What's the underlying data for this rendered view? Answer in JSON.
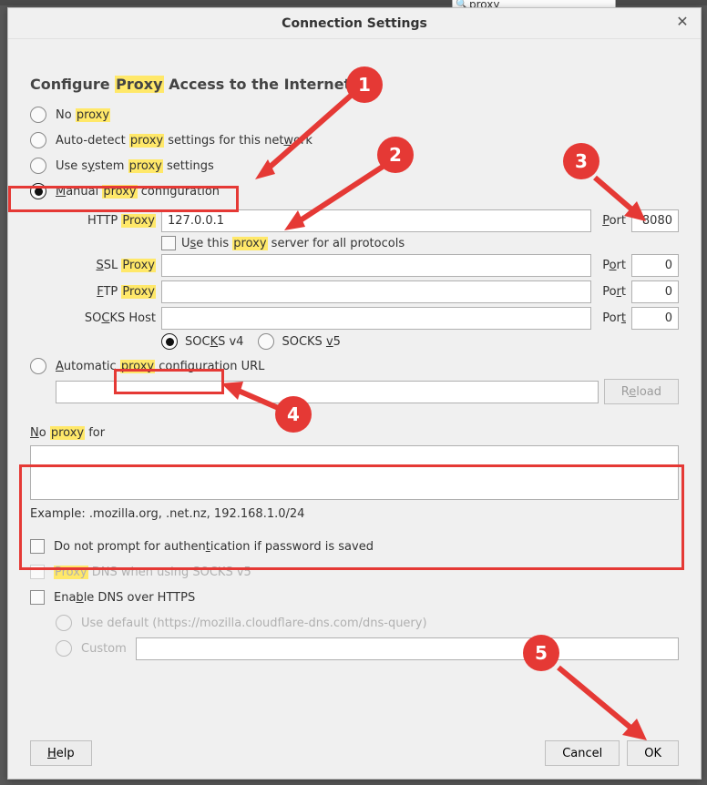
{
  "topSearch": {
    "value": "proxy"
  },
  "dialog": {
    "title": "Connection Settings",
    "heading_pre": "Configure ",
    "heading_hl": "Proxy",
    "heading_post": " Access to the Internet",
    "radios": {
      "no_proxy": {
        "pre": "No ",
        "hl": "proxy",
        "post": ""
      },
      "auto_detect": {
        "pre": "Auto-detect ",
        "hl": "proxy",
        "post": " settings for this net",
        "u": "w",
        "tail": "ork"
      },
      "system": {
        "pre": "Use s",
        "u": "y",
        "mid": "stem ",
        "hl": "proxy",
        "post": " settings"
      },
      "manual": {
        "u": "M",
        "mid": "anual ",
        "hl": "proxy",
        "post": " configuration"
      },
      "auto_url": {
        "u": "A",
        "mid": "utomatic ",
        "hl": "proxy",
        "post": " configuration URL"
      }
    },
    "http": {
      "label_pre": "HTTP ",
      "label_hl": "Proxy",
      "value": "127.0.0.1",
      "portlabel_u": "P",
      "portlabel_rest": "ort",
      "port": "8080"
    },
    "useAll": {
      "pre": "U",
      "u": "s",
      "mid": "e this ",
      "hl": "proxy",
      "post": " server for all protocols"
    },
    "ssl": {
      "label_u": "S",
      "label_mid": "SL ",
      "label_hl": "Proxy",
      "value": "",
      "port_u": "o",
      "port_pre": "P",
      "port_rest": "rt",
      "port": "0"
    },
    "ftp": {
      "label_u": "F",
      "label_mid": "TP ",
      "label_hl": "Proxy",
      "value": "",
      "port_u": "r",
      "port_pre": "Po",
      "port_rest": "t",
      "port": "0"
    },
    "socks": {
      "label_pre": "SO",
      "label_u": "C",
      "label_mid": "KS Host",
      "value": "",
      "port_pre": "Por",
      "port_u": "t",
      "port_rest": "",
      "port": "0"
    },
    "socksver": {
      "v4_pre": "SOC",
      "v4_u": "K",
      "v4_post": "S v4",
      "v5_pre": "SOCKS ",
      "v5_u": "v",
      "v5_post": "5"
    },
    "pac": {
      "value": "",
      "reload_u": "e",
      "reload_pre": "R",
      "reload_post": "load"
    },
    "noproxy": {
      "label_u": "N",
      "label_mid": "o ",
      "label_hl": "proxy",
      "label_post": " for",
      "value": "",
      "example": "Example: .mozilla.org, .net.nz, 192.168.1.0/24"
    },
    "noprompt": {
      "pre": "Do not prompt for authen",
      "u": "t",
      "post": "ication if password is saved"
    },
    "proxydns": {
      "hl": "Proxy",
      "post": " DNS when using SOCKS v5"
    },
    "doh": {
      "pre": "Ena",
      "u": "b",
      "post": "le DNS over HTTPS"
    },
    "dohdef": {
      "label": "Use default (https://mozilla.cloudflare-dns.com/dns-query)"
    },
    "dohcustom": {
      "label": "Custom",
      "value": ""
    },
    "buttons": {
      "help_u": "H",
      "help_rest": "elp",
      "cancel": "Cancel",
      "ok": "OK"
    }
  },
  "badges": {
    "b1": "1",
    "b2": "2",
    "b3": "3",
    "b4": "4",
    "b5": "5"
  }
}
